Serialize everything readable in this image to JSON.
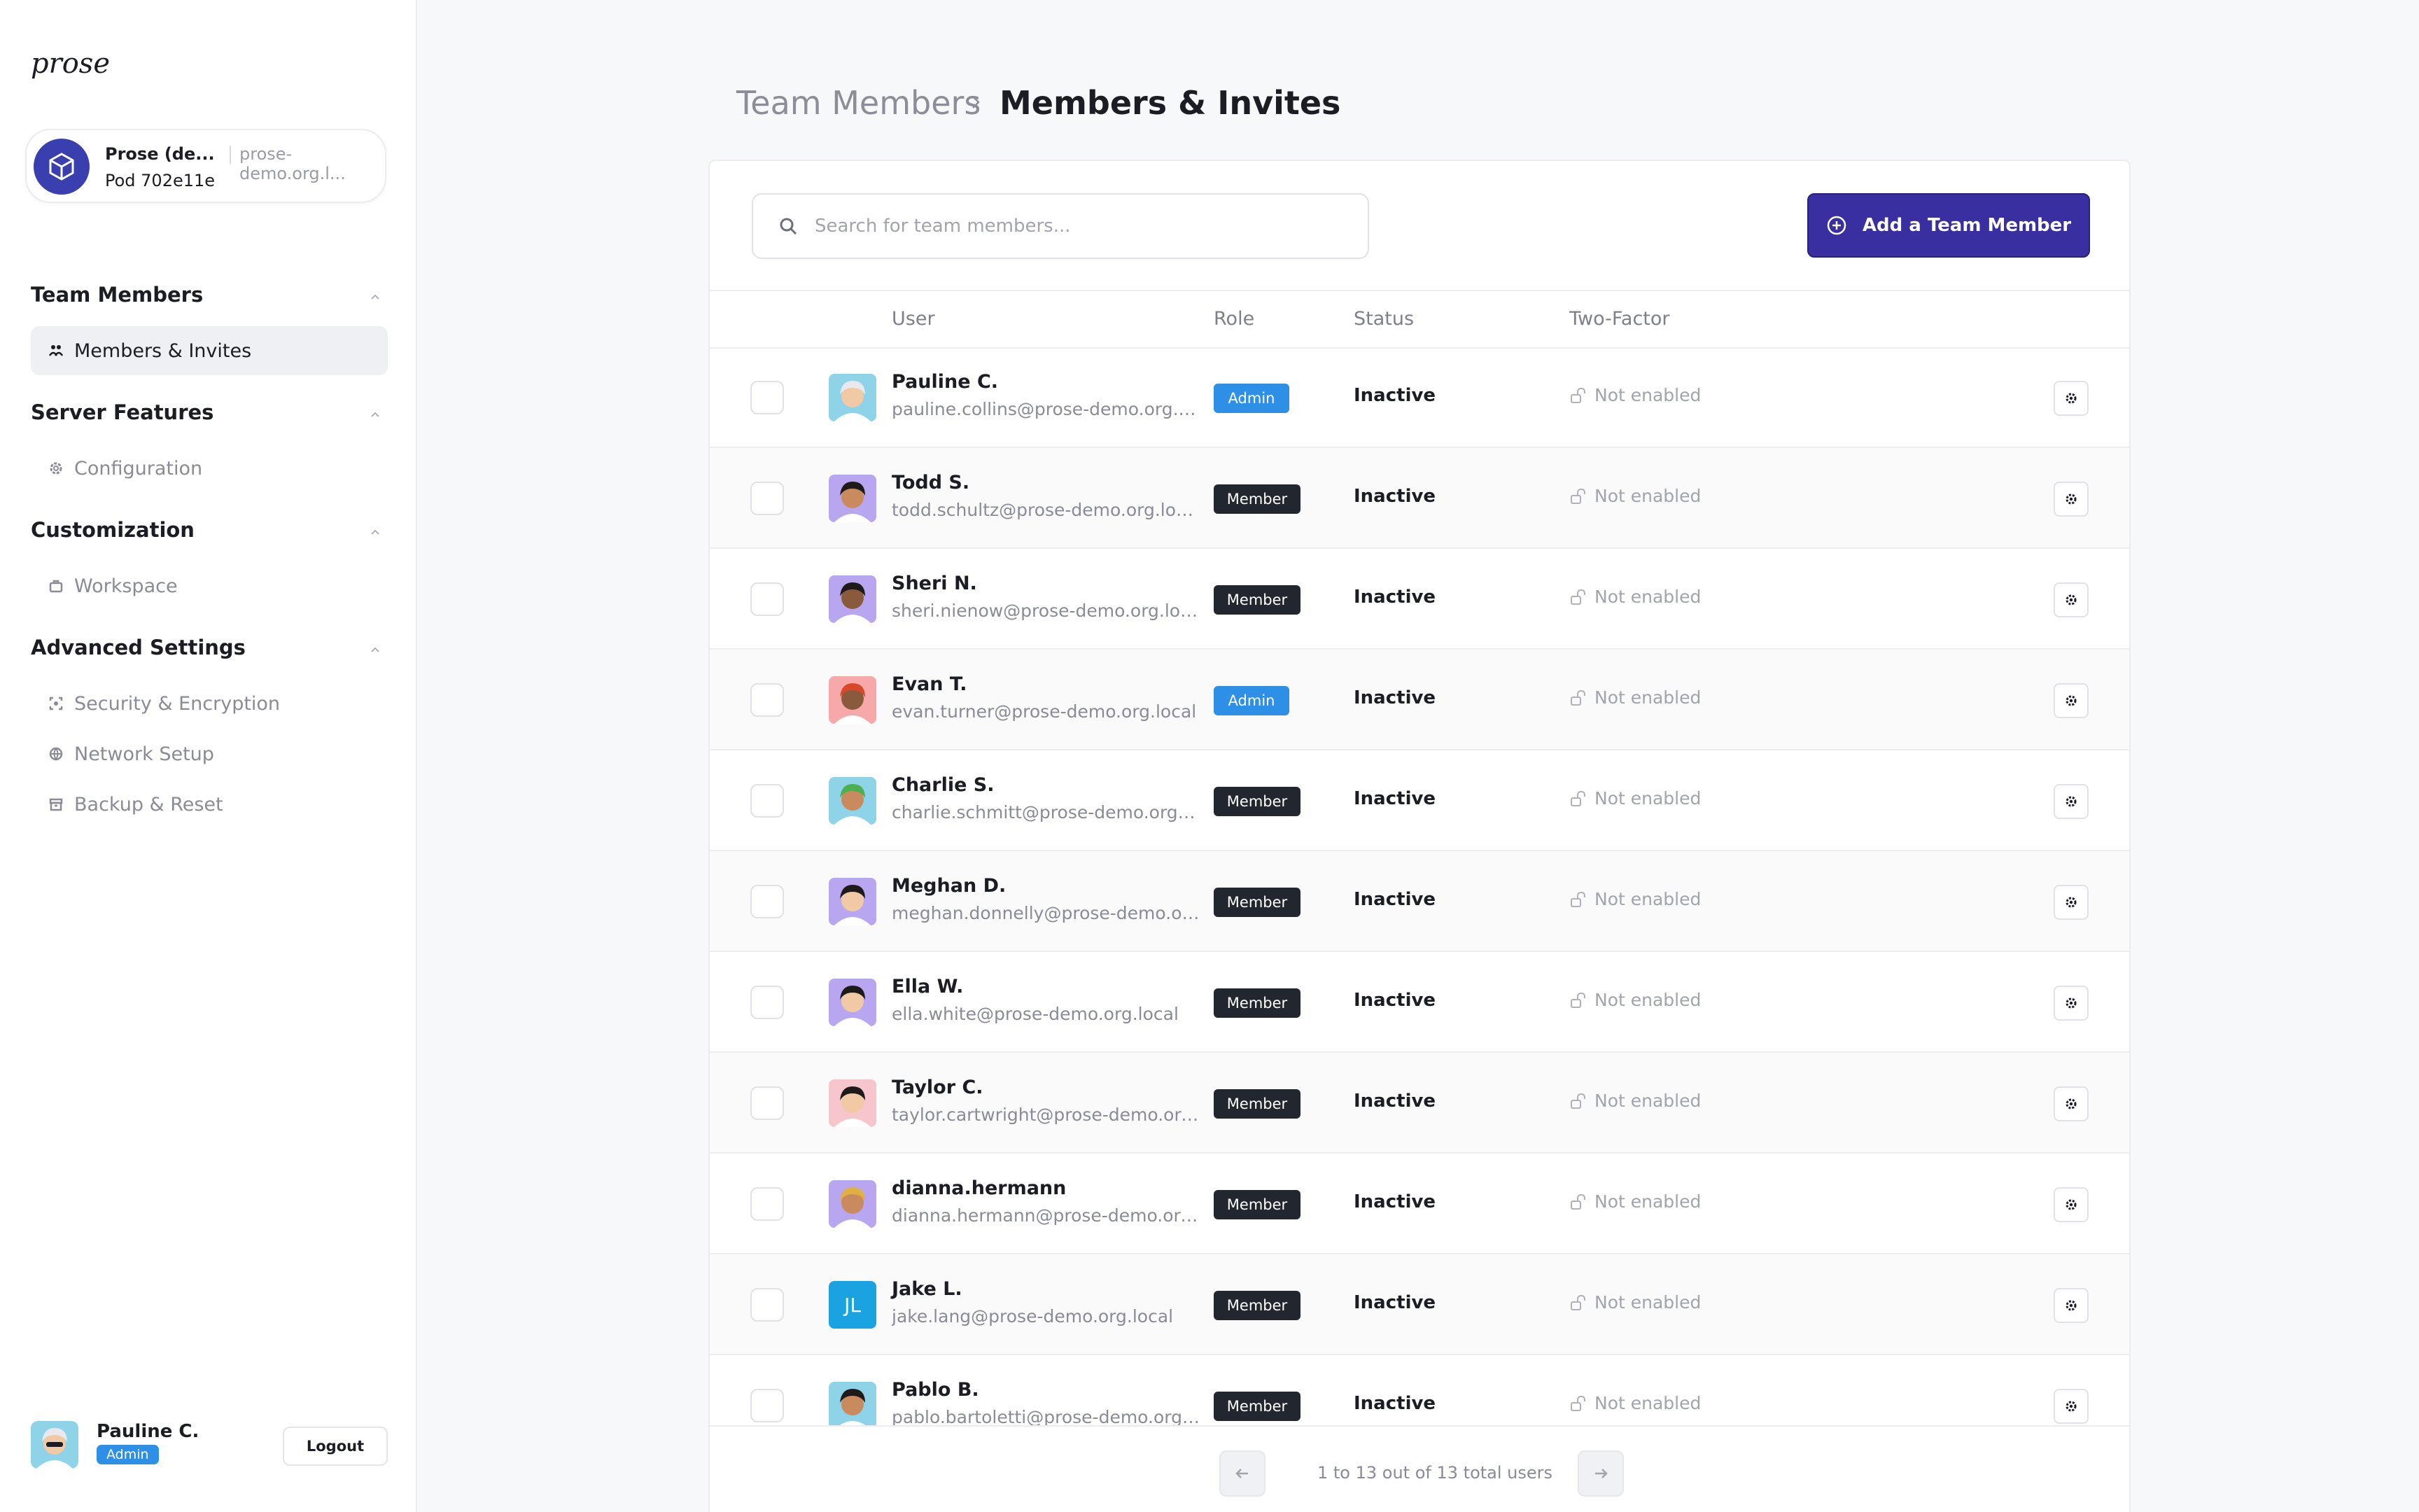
{
  "app": {
    "logo_text": "prose"
  },
  "org": {
    "name": "Prose (de...",
    "domain": "prose-demo.org.l...",
    "pod": "Pod 702e11e"
  },
  "sidebar": {
    "sections": [
      {
        "title": "Team Members",
        "items": [
          {
            "label": "Members & Invites",
            "icon": "people-icon",
            "active": true
          }
        ]
      },
      {
        "title": "Server Features",
        "items": [
          {
            "label": "Configuration",
            "icon": "gear-icon"
          }
        ]
      },
      {
        "title": "Customization",
        "items": [
          {
            "label": "Workspace",
            "icon": "briefcase-icon"
          }
        ]
      },
      {
        "title": "Advanced Settings",
        "items": [
          {
            "label": "Security & Encryption",
            "icon": "shield-icon"
          },
          {
            "label": "Network Setup",
            "icon": "globe-icon"
          },
          {
            "label": "Backup & Reset",
            "icon": "archive-icon"
          }
        ]
      }
    ]
  },
  "current_user": {
    "name": "Pauline C.",
    "role": "Admin",
    "logout_label": "Logout"
  },
  "breadcrumb": {
    "parent": "Team Members",
    "current": "Members & Invites"
  },
  "search": {
    "placeholder": "Search for team members..."
  },
  "add_button": {
    "label": "Add a Team Member"
  },
  "table": {
    "headers": {
      "user": "User",
      "role": "Role",
      "status": "Status",
      "two_factor": "Two-Factor"
    },
    "rows": [
      {
        "name": "Pauline C.",
        "email": "pauline.collins@prose-demo.org.local",
        "role": "Admin",
        "status": "Inactive",
        "two_factor": "Not enabled",
        "avatar_bg": "#8fd3e8",
        "skin": "#f1c9a5",
        "hair": "#e8e8ee"
      },
      {
        "name": "Todd S.",
        "email": "todd.schultz@prose-demo.org.local",
        "role": "Member",
        "status": "Inactive",
        "two_factor": "Not enabled",
        "avatar_bg": "#b9a6f0",
        "skin": "#c98a5e",
        "hair": "#1e1a1a"
      },
      {
        "name": "Sheri N.",
        "email": "sheri.nienow@prose-demo.org.local",
        "role": "Member",
        "status": "Inactive",
        "two_factor": "Not enabled",
        "avatar_bg": "#b9a6f0",
        "skin": "#8a5a3c",
        "hair": "#1e1a1a"
      },
      {
        "name": "Evan T.",
        "email": "evan.turner@prose-demo.org.local",
        "role": "Admin",
        "status": "Inactive",
        "two_factor": "Not enabled",
        "avatar_bg": "#f7a8a8",
        "skin": "#8a5a3c",
        "hair": "#d9482b"
      },
      {
        "name": "Charlie S.",
        "email": "charlie.schmitt@prose-demo.org.local",
        "role": "Member",
        "status": "Inactive",
        "two_factor": "Not enabled",
        "avatar_bg": "#8fd3e8",
        "skin": "#c98a5e",
        "hair": "#4caf50"
      },
      {
        "name": "Meghan D.",
        "email": "meghan.donnelly@prose-demo.org.l...",
        "role": "Member",
        "status": "Inactive",
        "two_factor": "Not enabled",
        "avatar_bg": "#b9a6f0",
        "skin": "#f1c9a5",
        "hair": "#1e1a1a"
      },
      {
        "name": "Ella W.",
        "email": "ella.white@prose-demo.org.local",
        "role": "Member",
        "status": "Inactive",
        "two_factor": "Not enabled",
        "avatar_bg": "#b9a6f0",
        "skin": "#f1c9a5",
        "hair": "#1e1a1a"
      },
      {
        "name": "Taylor C.",
        "email": "taylor.cartwright@prose-demo.org.l...",
        "role": "Member",
        "status": "Inactive",
        "two_factor": "Not enabled",
        "avatar_bg": "#f7c6cc",
        "skin": "#f1c9a5",
        "hair": "#1e1a1a"
      },
      {
        "name": "dianna.hermann",
        "email": "dianna.hermann@prose-demo.org.l...",
        "role": "Member",
        "status": "Inactive",
        "two_factor": "Not enabled",
        "avatar_bg": "#b9a6f0",
        "skin": "#c98a5e",
        "hair": "#e0b040"
      },
      {
        "name": "Jake L.",
        "email": "jake.lang@prose-demo.org.local",
        "role": "Member",
        "status": "Inactive",
        "two_factor": "Not enabled",
        "initials": "JL",
        "avatar_bg": "#1aa3e0"
      },
      {
        "name": "Pablo B.",
        "email": "pablo.bartoletti@prose-demo.org.lo...",
        "role": "Member",
        "status": "Inactive",
        "two_factor": "Not enabled",
        "avatar_bg": "#8fd3e8",
        "skin": "#c98a5e",
        "hair": "#1e1a1a"
      }
    ]
  },
  "pagination": {
    "text": "1 to 13 out of 13 total users"
  },
  "colors": {
    "accent": "#3a2fa0",
    "admin_badge": "#2e8fe6",
    "member_badge": "#22262e"
  }
}
